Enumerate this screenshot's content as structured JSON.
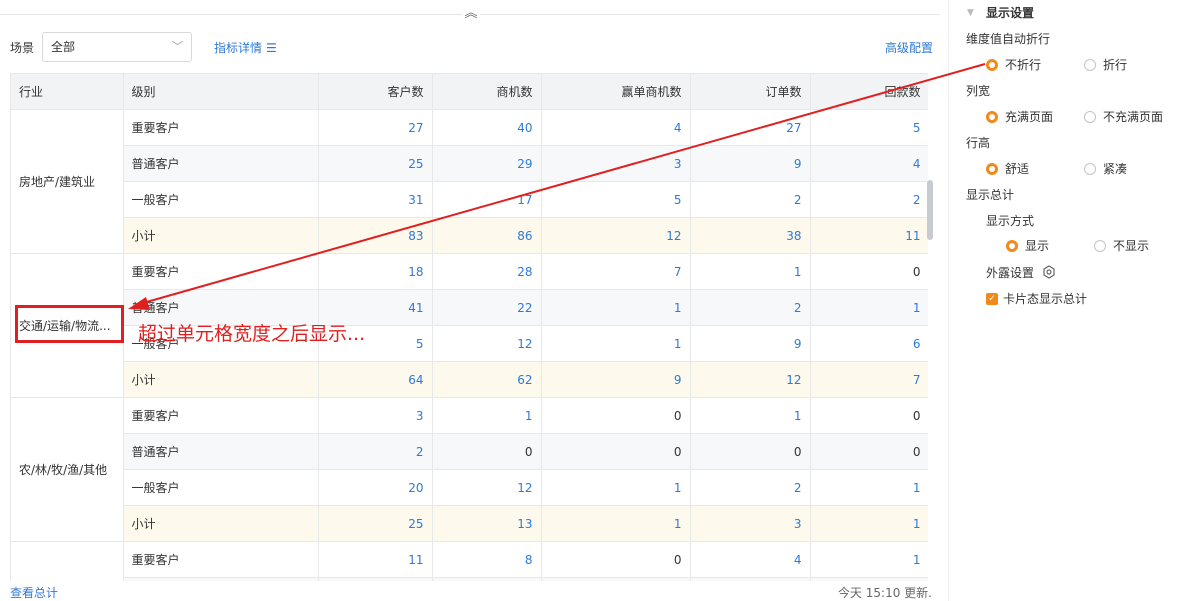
{
  "toolbar": {
    "scene_label": "场景",
    "scene_value": "全部",
    "metric_link": "指标详情",
    "advanced_link": "高级配置"
  },
  "table": {
    "headers": [
      "行业",
      "级别",
      "客户数",
      "商机数",
      "赢单商机数",
      "订单数",
      "回款数"
    ],
    "groups": [
      {
        "industry": "房地产/建筑业",
        "rows": [
          {
            "level": "重要客户",
            "values": [
              "27",
              "40",
              "4",
              "27",
              "5"
            ]
          },
          {
            "level": "普通客户",
            "values": [
              "25",
              "29",
              "3",
              "9",
              "4"
            ]
          },
          {
            "level": "一般客户",
            "values": [
              "31",
              "17",
              "5",
              "2",
              "2"
            ]
          },
          {
            "level": "小计",
            "values": [
              "83",
              "86",
              "12",
              "38",
              "11"
            ]
          }
        ]
      },
      {
        "industry": "交通/运输/物流...",
        "rows": [
          {
            "level": "重要客户",
            "values": [
              "18",
              "28",
              "7",
              "1",
              "0"
            ]
          },
          {
            "level": "普通客户",
            "values": [
              "41",
              "22",
              "1",
              "2",
              "1"
            ]
          },
          {
            "level": "一般客户",
            "values": [
              "5",
              "12",
              "1",
              "9",
              "6"
            ]
          },
          {
            "level": "小计",
            "values": [
              "64",
              "62",
              "9",
              "12",
              "7"
            ]
          }
        ]
      },
      {
        "industry": "农/林/牧/渔/其他",
        "rows": [
          {
            "level": "重要客户",
            "values": [
              "3",
              "1",
              "0",
              "1",
              "0"
            ]
          },
          {
            "level": "普通客户",
            "values": [
              "2",
              "0",
              "0",
              "0",
              "0"
            ]
          },
          {
            "level": "一般客户",
            "values": [
              "20",
              "12",
              "1",
              "2",
              "1"
            ]
          },
          {
            "level": "小计",
            "values": [
              "25",
              "13",
              "1",
              "3",
              "1"
            ]
          }
        ]
      },
      {
        "industry": "",
        "rows": [
          {
            "level": "重要客户",
            "values": [
              "11",
              "8",
              "0",
              "4",
              "1"
            ]
          },
          {
            "level": "",
            "values": [
              "",
              "",
              "",
              "",
              ""
            ]
          }
        ]
      }
    ]
  },
  "footer": {
    "view_total": "查看总计",
    "updated": "今天 15:10 更新."
  },
  "panel": {
    "title": "显示设置",
    "wrap_label": "维度值自动折行",
    "wrap_options": [
      "不折行",
      "折行"
    ],
    "colwidth_label": "列宽",
    "colwidth_options": [
      "充满页面",
      "不充满页面"
    ],
    "rowheight_label": "行高",
    "rowheight_options": [
      "舒适",
      "紧凑"
    ],
    "total_label": "显示总计",
    "display_mode_label": "显示方式",
    "display_mode_options": [
      "显示",
      "不显示"
    ],
    "exposed_label": "外露设置",
    "card_total_label": "卡片态显示总计"
  },
  "annotation": {
    "text": "超过单元格宽度之后显示..."
  },
  "colors": {
    "accent": "#f08a1c",
    "link": "#2f7ad6",
    "annotation": "#e02020"
  }
}
